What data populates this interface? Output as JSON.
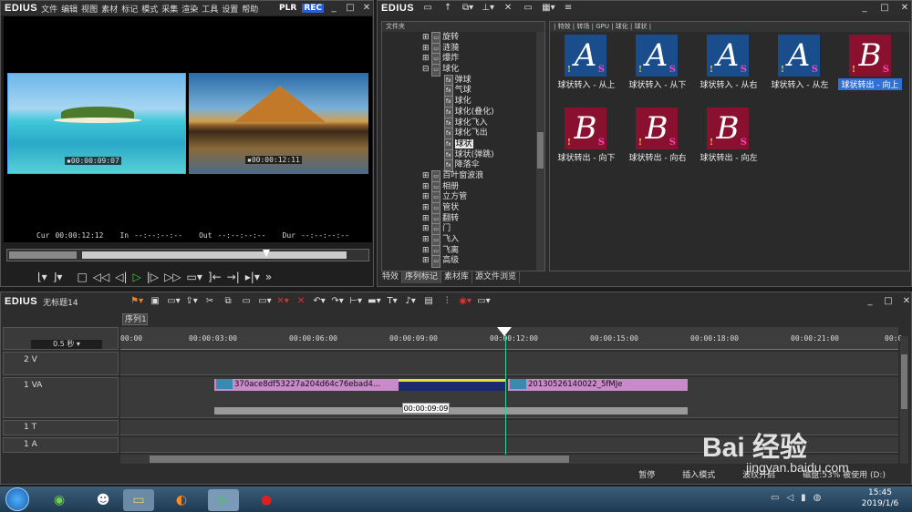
{
  "player": {
    "app_name": "EDIUS",
    "menu": [
      "文件",
      "编辑",
      "视图",
      "素材",
      "标记",
      "模式",
      "采集",
      "渲染",
      "工具",
      "设置",
      "帮助"
    ],
    "plr": "PLR",
    "rec": "REC",
    "preview_left_tc": "00:00:09:07",
    "preview_right_tc": "00:00:12:11",
    "cur_label": "Cur",
    "cur_value": "00:00:12:12",
    "in_label": "In",
    "in_value": "--:--:--:--",
    "out_label": "Out",
    "out_value": "--:--:--:--",
    "dur_label": "Dur",
    "dur_value": "--:--:--:--"
  },
  "browser": {
    "app_name": "EDIUS",
    "tree_header": "文件夹",
    "path": "| 特效 | 转场 | GPU | 球化 | 球状 |",
    "tree_items": [
      "旋转",
      "涟漪",
      "爆炸",
      "球化",
      "弹球",
      "气球",
      "球化",
      "球化(叠化)",
      "球化飞入",
      "球化飞出",
      "球状",
      "球状(弹跳)",
      "降落伞",
      "百叶窗波浪",
      "相册",
      "立方管",
      "管状",
      "翻转",
      "门",
      "飞入",
      "飞离",
      "高级"
    ],
    "effects": [
      {
        "label": "球状转入 - 从上",
        "letter": "A",
        "color": "blue",
        "selected": false
      },
      {
        "label": "球状转入 - 从下",
        "letter": "A",
        "color": "blue",
        "selected": false
      },
      {
        "label": "球状转入 - 从右",
        "letter": "A",
        "color": "blue",
        "selected": false
      },
      {
        "label": "球状转入 - 从左",
        "letter": "A",
        "color": "blue",
        "selected": false
      },
      {
        "label": "球状转出 - 向上",
        "letter": "B",
        "color": "red",
        "selected": true
      },
      {
        "label": "球状转出 - 向下",
        "letter": "B",
        "color": "red",
        "selected": false
      },
      {
        "label": "球状转出 - 向右",
        "letter": "B",
        "color": "red",
        "selected": false
      },
      {
        "label": "球状转出 - 向左",
        "letter": "B",
        "color": "red",
        "selected": false
      }
    ],
    "tabs": [
      "特效",
      "序列标记",
      "素材库",
      "源文件浏览"
    ]
  },
  "timeline": {
    "app_name": "EDIUS",
    "project": "无标题14",
    "sequence_tab": "序列1",
    "scale": "0.5 秒",
    "ruler": [
      "00:00",
      "00:00:03:00",
      "00:00:06:00",
      "00:00:09:00",
      "00:00:12:00",
      "00:00:15:00",
      "00:00:18:00",
      "00:00:21:00",
      "00:0"
    ],
    "tracks": [
      "2 V",
      "1 VA",
      "1 T",
      "1 A"
    ],
    "clip_a": "370ace8df53227a204d64c76ebad4...",
    "clip_b": "20130526140022_5fMJe",
    "tooltip": "00:00:09:09",
    "status": [
      "暂停",
      "插入模式",
      "波纹开启",
      "磁盘:53% 被使用 (D:)"
    ]
  },
  "taskbar": {
    "time": "15:45",
    "date": "2019/1/6"
  },
  "watermark": {
    "text": "Bai 经验",
    "url": "jingyan.baidu.com"
  }
}
